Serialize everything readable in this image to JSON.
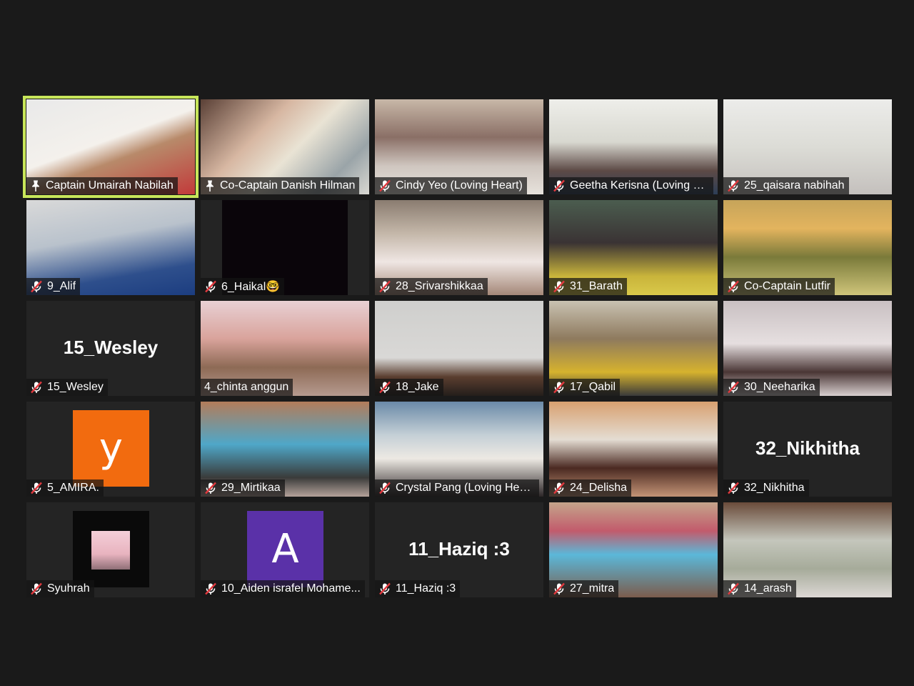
{
  "meeting": {
    "active_speaker_index": 0,
    "colors": {
      "background": "#1a1a1a",
      "tile": "#242424",
      "active_border": "#c8e65a",
      "muted_icon": "#e0393e",
      "avatar_orange": "#f26b0f",
      "avatar_purple": "#5a31a8"
    },
    "participants": [
      {
        "name": "Captain Umairah Nabilah",
        "icon": "pin-icon",
        "video": true
      },
      {
        "name": "Co-Captain Danish Hilman",
        "icon": "pin-icon",
        "video": true
      },
      {
        "name": "Cindy Yeo (Loving Heart)",
        "icon": "muted-mic-icon",
        "video": true
      },
      {
        "name": "Geetha Kerisna (Loving H...",
        "icon": "muted-mic-icon",
        "video": true
      },
      {
        "name": "25_qaisara nabihah",
        "icon": "muted-mic-icon",
        "video": true
      },
      {
        "name": "9_Alif",
        "icon": "muted-mic-icon",
        "video": true
      },
      {
        "name": "6_Haikal🤓",
        "icon": "muted-mic-icon",
        "video": true
      },
      {
        "name": "28_Srivarshikkaa",
        "icon": "muted-mic-icon",
        "video": true
      },
      {
        "name": "31_Barath",
        "icon": "muted-mic-icon",
        "video": true
      },
      {
        "name": "Co-Captain Lutfir",
        "icon": "muted-mic-icon",
        "video": true
      },
      {
        "name": "15_Wesley",
        "icon": "muted-mic-icon",
        "video": false,
        "display_name": "15_Wesley"
      },
      {
        "name": "4_chinta anggun",
        "icon": "none",
        "video": true
      },
      {
        "name": "18_Jake",
        "icon": "muted-mic-icon",
        "video": true
      },
      {
        "name": "17_Qabil",
        "icon": "muted-mic-icon",
        "video": true
      },
      {
        "name": "30_Neeharika",
        "icon": "muted-mic-icon",
        "video": true
      },
      {
        "name": "5_AMIRA.",
        "icon": "muted-mic-icon",
        "video": false,
        "avatar_letter": "y",
        "avatar_style": "orange"
      },
      {
        "name": "29_Mirtikaa",
        "icon": "muted-mic-icon",
        "video": true
      },
      {
        "name": "Crystal Pang (Loving Hea...",
        "icon": "muted-mic-icon",
        "video": true
      },
      {
        "name": "24_Delisha",
        "icon": "muted-mic-icon",
        "video": true
      },
      {
        "name": "32_Nikhitha",
        "icon": "muted-mic-icon",
        "video": false,
        "display_name": "32_Nikhitha"
      },
      {
        "name": "Syuhrah",
        "icon": "muted-mic-icon",
        "video": false,
        "avatar_style": "photo"
      },
      {
        "name": "10_Aiden israfel Mohame...",
        "icon": "muted-mic-icon",
        "video": false,
        "avatar_letter": "A",
        "avatar_style": "purple"
      },
      {
        "name": "11_Haziq :3",
        "icon": "muted-mic-icon",
        "video": false,
        "display_name": "11_Haziq :3"
      },
      {
        "name": "27_mitra",
        "icon": "muted-mic-icon",
        "video": true
      },
      {
        "name": "14_arash",
        "icon": "muted-mic-icon",
        "video": true
      }
    ]
  }
}
